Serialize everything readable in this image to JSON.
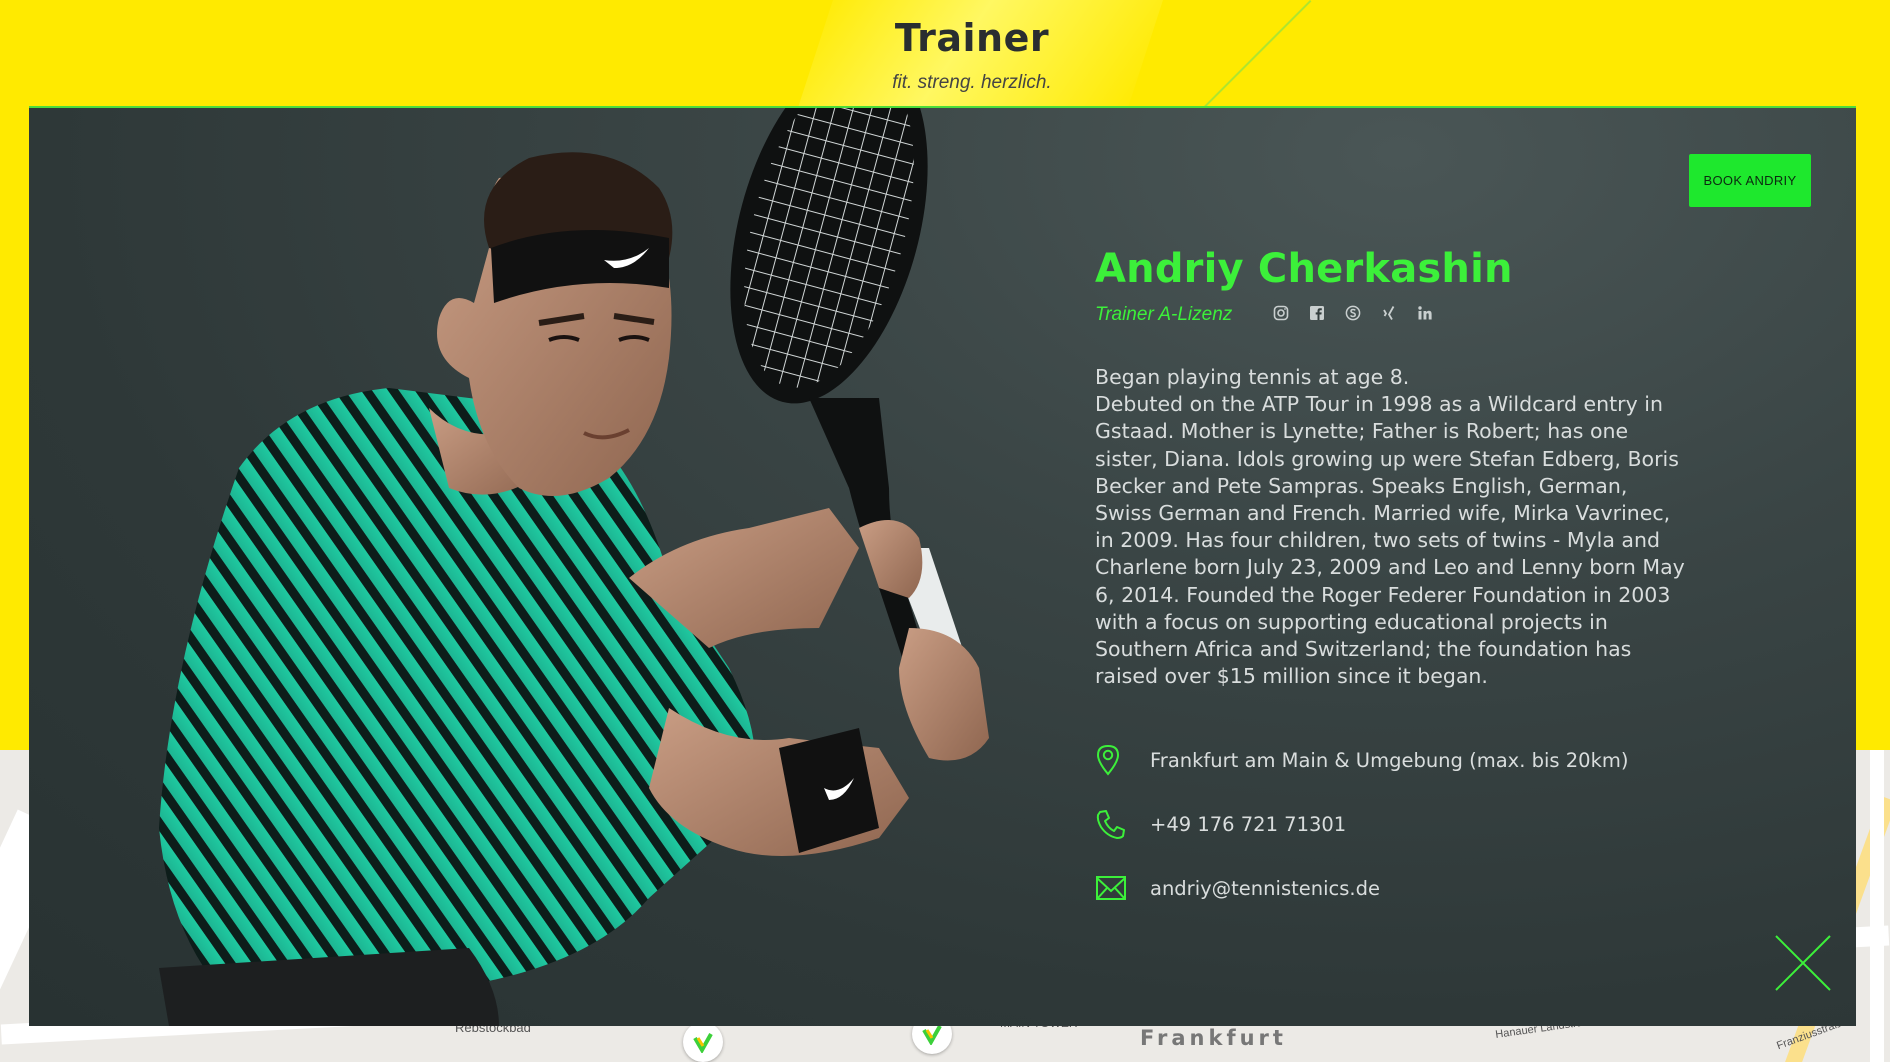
{
  "header": {
    "title": "Trainer",
    "tagline": "fit. streng. herzlich."
  },
  "modal": {
    "book_button": "BOOK ANDRIY",
    "name": "Andriy Cherkashin",
    "license": "Trainer A-Lizenz",
    "social": [
      {
        "icon": "instagram-icon"
      },
      {
        "icon": "facebook-icon"
      },
      {
        "icon": "skype-icon"
      },
      {
        "icon": "xing-icon"
      },
      {
        "icon": "linkedin-icon"
      }
    ],
    "bio_line1": "Began playing tennis at age 8.",
    "bio_body": "Debuted on the ATP Tour in 1998 as a Wildcard entry in Gstaad. Mother is Lynette; Father is Robert; has one sister, Diana. Idols growing up were Stefan Edberg, Boris Becker and Pete Sampras. Speaks English, German, Swiss German and French. Married wife, Mirka Vavrinec, in 2009. Has four children, two sets of twins - Myla and Charlene born July 23, 2009 and Leo and Lenny born May 6, 2014. Founded the Roger Federer Foundation in 2003 with a focus on supporting educational projects in Southern Africa and Switzerland; the foundation has raised over $15 million since it began.",
    "contact": {
      "location": "Frankfurt am Main & Umgebung (max. bis 20km)",
      "phone": "+49 176 721 71301",
      "email": "andriy@tennistenics.de"
    }
  },
  "map": {
    "labels": [
      "Rebstockbad",
      "MAIN TOWER",
      "Frankfurt",
      "Hanauer Landstraße",
      "Franziusstraße"
    ]
  },
  "colors": {
    "accent": "#3cf03a",
    "background": "#ffea00",
    "panel": "#2e3838"
  }
}
